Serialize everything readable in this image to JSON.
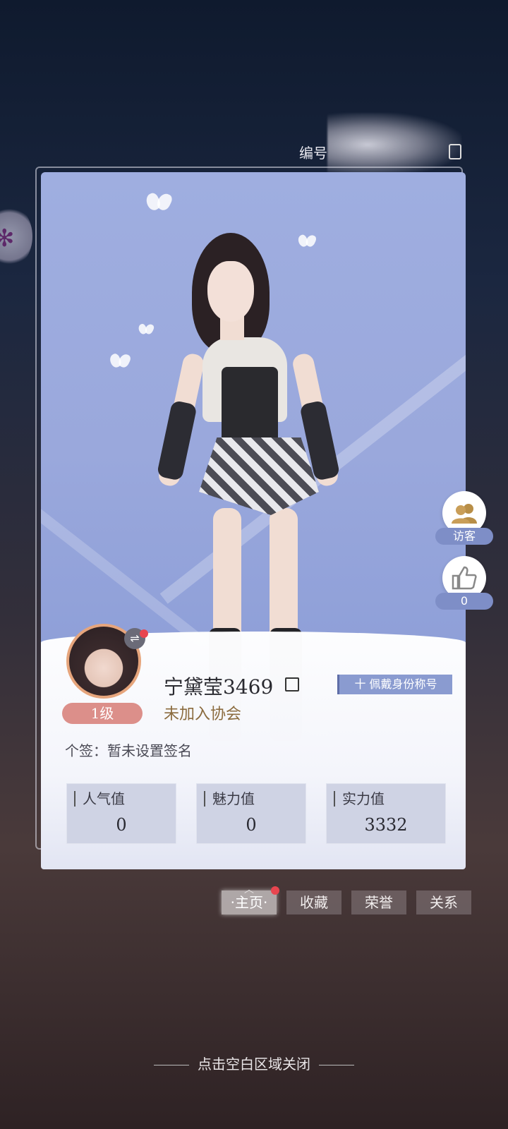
{
  "header": {
    "id_label": "编号"
  },
  "side_buttons": {
    "visitors_label": "访客",
    "likes_count": "0"
  },
  "profile": {
    "name": "宁黛莹3469",
    "level": "1级",
    "guild": "未加入协会",
    "title_button": "十 佩戴身份称号",
    "signature": "个签：暂未设置签名",
    "stats": [
      {
        "label": "人气值",
        "value": "0"
      },
      {
        "label": "魅力值",
        "value": "0"
      },
      {
        "label": "实力值",
        "value": "3332"
      }
    ]
  },
  "tabs": [
    "·主页·",
    "收藏",
    "荣誉",
    "关系"
  ],
  "footer": {
    "close_hint": "点击空白区域关闭"
  },
  "colors": {
    "accent": "#8a9bd0",
    "level_badge": "#dc8f8a",
    "guild_text": "#8b6b3e",
    "notification": "#e8454f"
  }
}
